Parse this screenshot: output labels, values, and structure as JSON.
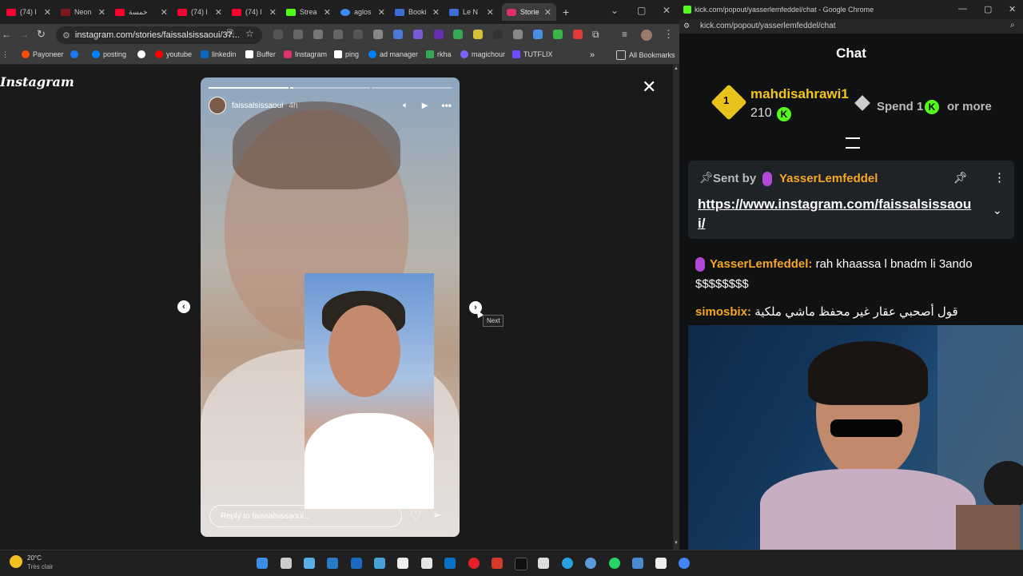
{
  "browser_left": {
    "tabs": [
      {
        "label": "(74) l",
        "color": "#ff0033"
      },
      {
        "label": "Neon",
        "color": "#7a1a1a"
      },
      {
        "label": "خمسة",
        "color": "#ff0033"
      },
      {
        "label": "(74) l",
        "color": "#ff0033"
      },
      {
        "label": "(74) l",
        "color": "#ff0033"
      },
      {
        "label": "Strea",
        "color": "#53fc18"
      },
      {
        "label": "aglos",
        "color": "#4285f4"
      },
      {
        "label": "Booki",
        "color": "#3b6fd6"
      },
      {
        "label": "Le N",
        "color": "#3b6fd6"
      },
      {
        "label": "Storie",
        "color": "#e1306c"
      }
    ],
    "new_tab": "+",
    "url": "instagram.com/stories/faissalsissaoui/37...",
    "bookmarks": [
      {
        "label": "Payoneer",
        "color": "#ff4800"
      },
      {
        "label": "",
        "color": "#1877f2"
      },
      {
        "label": "posting",
        "color": "#0081fb"
      },
      {
        "label": "",
        "color": "#ffffff"
      },
      {
        "label": "youtube",
        "color": "#ff0000"
      },
      {
        "label": "linkedin",
        "color": "#0a66c2"
      },
      {
        "label": "Buffer",
        "color": "#ffffff"
      },
      {
        "label": "Instagram",
        "color": "#e1306c"
      },
      {
        "label": "ping",
        "color": "#ffffff"
      },
      {
        "label": "ad manager",
        "color": "#0081fb"
      },
      {
        "label": "rkha",
        "color": "#34a853"
      },
      {
        "label": "magichour",
        "color": "#7b61ff"
      },
      {
        "label": "TUTFLIX",
        "color": "#6f4cff"
      }
    ],
    "more_bookmarks": "»",
    "all_bookmarks": "All Bookmarks"
  },
  "instagram": {
    "logo": "Instagram",
    "close": "✕",
    "story": {
      "username": "faissalsissaoui",
      "time": "4h",
      "reply_placeholder": "Reply to faissalsissaoui...",
      "progress_segments": 3,
      "progress_current": 2,
      "progress_current_fill": 0.04
    },
    "prev": "‹",
    "next": "›",
    "next_tooltip": "Next"
  },
  "kick": {
    "title": "kick.com/popout/yasserlemfeddel/chat - Google Chrome",
    "url": "kick.com/popout/yasserlemfeddel/chat",
    "chat_title": "Chat",
    "leader": {
      "rank": "1",
      "name": "mahdisahrawi1",
      "amount": "210",
      "spend_label": "Spend 1",
      "or_more": "or more"
    },
    "pinned": {
      "sent_by_label": "Sent by",
      "sender": "YasserLemfeddel",
      "link": "https://www.instagram.com/faissalsissaoui/"
    },
    "messages": [
      {
        "user": "YasserLemfeddel",
        "user_color": "#f5a623",
        "text": "rah khaassa l bnadm li 3ando $$$$$$$$",
        "mic": true
      },
      {
        "user": "simosbix",
        "user_color": "#f5a623",
        "text": "قول أصحبي عقار غير محفظ ماشي ملكية",
        "mic": false
      }
    ]
  },
  "taskbar": {
    "weather_temp": "20°C",
    "weather_desc": "Très clair"
  }
}
